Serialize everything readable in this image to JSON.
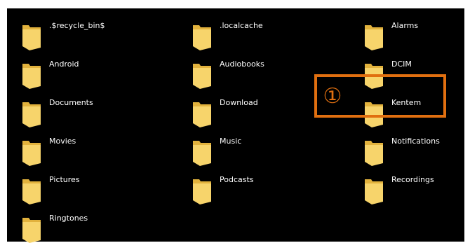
{
  "folders": [
    {
      "label": ".$recycle_bin$"
    },
    {
      "label": ".localcache"
    },
    {
      "label": "Alarms"
    },
    {
      "label": "Android"
    },
    {
      "label": "Audiobooks"
    },
    {
      "label": "DCIM"
    },
    {
      "label": "Documents"
    },
    {
      "label": "Download"
    },
    {
      "label": "Kentem"
    },
    {
      "label": "Movies"
    },
    {
      "label": "Music"
    },
    {
      "label": "Notifications"
    },
    {
      "label": "Pictures"
    },
    {
      "label": "Podcasts"
    },
    {
      "label": "Recordings"
    },
    {
      "label": "Ringtones"
    }
  ],
  "annotation": {
    "marker": "①",
    "target": "Kentem",
    "color": "#e06f10"
  },
  "colors": {
    "background": "#000000",
    "folder_body": "#f7d46b",
    "folder_back": "#e2b23d",
    "text": "#ffffff"
  },
  "icons": {
    "folder": "folder-icon"
  }
}
